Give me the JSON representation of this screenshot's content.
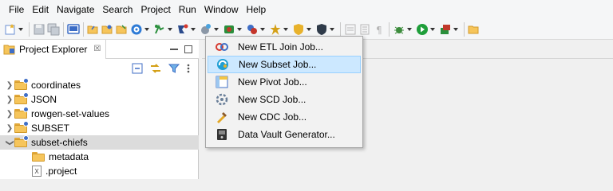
{
  "menubar": {
    "items": [
      "File",
      "Edit",
      "Navigate",
      "Search",
      "Project",
      "Run",
      "Window",
      "Help"
    ]
  },
  "toolbar": {
    "buttons": [
      {
        "name": "new-wizard",
        "icon": "new-wizard-icon",
        "color": "#6a8fd3"
      },
      {
        "name": "save",
        "icon": "save-icon",
        "color": "#9aa0a8"
      },
      {
        "name": "save-all",
        "icon": "save-all-icon",
        "color": "#9aa0a8"
      },
      {
        "name": "console",
        "icon": "console-icon",
        "color": "#3a6bc5"
      },
      {
        "name": "open-folder-1",
        "icon": "folder-open-icon",
        "color": "#e2a83a"
      },
      {
        "name": "open-folder-2",
        "icon": "folder-open-icon",
        "color": "#e2a83a"
      },
      {
        "name": "open-folder-3",
        "icon": "folder-open-icon",
        "color": "#e2a83a"
      },
      {
        "name": "target",
        "icon": "target-icon",
        "color": "#2e7bd6"
      },
      {
        "name": "run-tool",
        "icon": "run-tool-icon",
        "color": "#2a8f3c"
      },
      {
        "name": "new-job",
        "icon": "new-job-icon",
        "color": "#2b4b8c"
      },
      {
        "name": "tools",
        "icon": "tools-icon",
        "color": "#6f7a88"
      },
      {
        "name": "deploy",
        "icon": "deploy-icon",
        "color": "#c03a2b"
      },
      {
        "name": "bolt",
        "icon": "bolt-icon",
        "color": "#c4352a"
      },
      {
        "name": "wizard",
        "icon": "wizard-icon",
        "color": "#d4a017"
      },
      {
        "name": "shield-gold",
        "icon": "shield-icon",
        "color": "#e8b22c"
      },
      {
        "name": "shield-dark",
        "icon": "shield-dark-icon",
        "color": "#2f3b4a"
      },
      {
        "name": "disabled-1",
        "icon": "disabled-icon",
        "color": "#b7b7b7"
      },
      {
        "name": "disabled-2",
        "icon": "disabled-icon",
        "color": "#b7b7b7"
      },
      {
        "name": "pilcrow",
        "icon": "pilcrow-icon",
        "color": "#b7b7b7"
      },
      {
        "name": "debug",
        "icon": "debug-icon",
        "color": "#3c8c3c"
      },
      {
        "name": "run",
        "icon": "run-icon",
        "color": "#1e9e3a"
      },
      {
        "name": "external-tools",
        "icon": "external-tools-icon",
        "color": "#c0392b"
      },
      {
        "name": "open-type",
        "icon": "folder-open-icon",
        "color": "#e2a83a"
      }
    ]
  },
  "explorer": {
    "title": "Project Explorer",
    "close_glyph": "☒",
    "tree": [
      {
        "label": "coordinates",
        "expanded": false,
        "level": 0,
        "type": "project"
      },
      {
        "label": "JSON",
        "expanded": false,
        "level": 0,
        "type": "project"
      },
      {
        "label": "rowgen-set-values",
        "expanded": false,
        "level": 0,
        "type": "project"
      },
      {
        "label": "SUBSET",
        "expanded": false,
        "level": 0,
        "type": "project"
      },
      {
        "label": "subset-chiefs",
        "expanded": true,
        "level": 0,
        "type": "project",
        "selected": true
      },
      {
        "label": "metadata",
        "level": 1,
        "type": "folder"
      },
      {
        "label": ".project",
        "level": 1,
        "type": "file"
      }
    ]
  },
  "dropdown": {
    "items": [
      {
        "label": "New ETL Join Job...",
        "icon": "etl-join-icon",
        "color": "#d63a2f",
        "highlight": false
      },
      {
        "label": "New Subset Job...",
        "icon": "subset-job-icon",
        "color": "#1f9fd4",
        "highlight": true
      },
      {
        "label": "New Pivot Job...",
        "icon": "pivot-job-icon",
        "color": "#3d6fc7",
        "highlight": false
      },
      {
        "label": "New SCD Job...",
        "icon": "scd-job-icon",
        "color": "#6a7f99",
        "highlight": false
      },
      {
        "label": "New CDC Job...",
        "icon": "cdc-job-icon",
        "color": "#e4a826",
        "highlight": false
      },
      {
        "label": "Data Vault Generator...",
        "icon": "data-vault-icon",
        "color": "#333333",
        "highlight": false
      }
    ]
  }
}
